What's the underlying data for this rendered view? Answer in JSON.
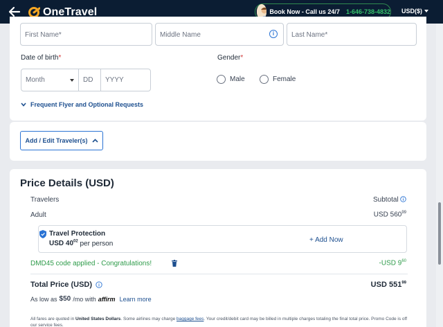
{
  "header": {
    "brand": "OneTravel",
    "book_now": "Book Now - Call us 24/7",
    "phone": "1-646-738-4832",
    "currency": "USD($)"
  },
  "traveler_form": {
    "first_name_placeholder": "First Name*",
    "middle_name_placeholder": "Middle Name",
    "last_name_placeholder": "Last Name*",
    "dob_label": "Date of birth",
    "dob_month": "Month",
    "dob_day": "DD",
    "dob_year": "YYYY",
    "gender_label": "Gender",
    "gender_options": [
      "Male",
      "Female"
    ],
    "frequent_flyer_link": "Frequent Flyer and Optional Requests"
  },
  "edit_travelers_button": "Add / Edit Traveler(s)",
  "price_details": {
    "title": "Price Details (USD)",
    "travelers_label": "Travelers",
    "subtotal_label": "Subtotal",
    "adult_label": "Adult",
    "adult_price_main": "USD 560",
    "adult_price_cents": "99",
    "travel_protection": {
      "title": "Travel Protection",
      "price_main": "USD 40",
      "price_cents": "02",
      "per": "per person",
      "add_now": "+ Add Now"
    },
    "promo_text": "DMD45 code applied - Congratulations!",
    "discount_main": "-USD 9",
    "discount_cents": "60",
    "total_label": "Total Price (USD)",
    "total_main": "USD 551",
    "total_cents": "99",
    "as_low_as_prefix": "As low as",
    "as_low_as_amount": "$50",
    "as_low_as_suffix": "/mo with",
    "affirm": "affirm",
    "learn_more": "Learn more",
    "disclaimer_a": "All fares are quoted in ",
    "disclaimer_bold": "United States Dollars",
    "disclaimer_b": ". Some airlines may charge ",
    "disclaimer_link": "baggage fees",
    "disclaimer_c": ". Your credit/debit card may be billed in multiple charges totaling the final total price. Promo Code is off our service fees."
  },
  "colors": {
    "header_bg": "#0b1d33",
    "accent_blue": "#1d4f8f",
    "success_green": "#2e9b4a",
    "brand_orange": "#f5a623"
  }
}
